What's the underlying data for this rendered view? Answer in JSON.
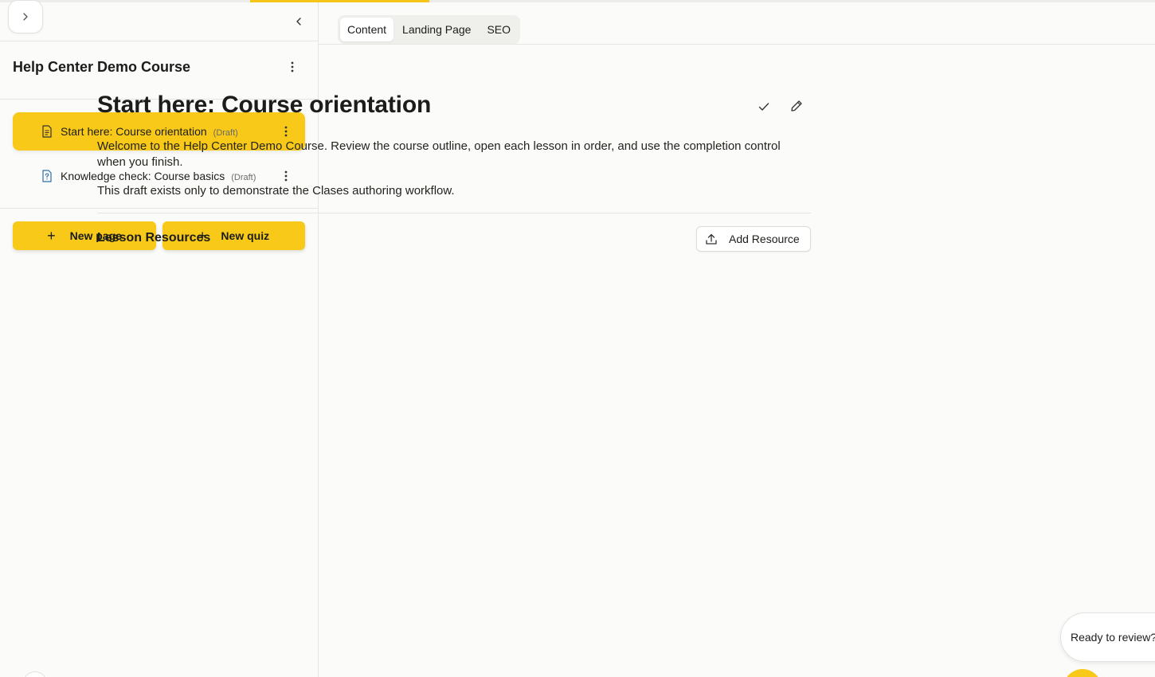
{
  "sidebar": {
    "course_title": "Help Center Demo Course",
    "lessons": [
      {
        "label": "Start here: Course orientation",
        "status": "(Draft)",
        "icon": "document-icon",
        "active": true
      },
      {
        "label": "Knowledge check: Course basics",
        "status": "(Draft)",
        "icon": "quiz-icon",
        "active": false
      }
    ],
    "new_page_label": "New page",
    "new_quiz_label": "New quiz"
  },
  "tabs": [
    {
      "label": "Content",
      "active": true
    },
    {
      "label": "Landing Page",
      "active": false
    },
    {
      "label": "SEO",
      "active": false
    }
  ],
  "main": {
    "title": "Start here: Course orientation",
    "paragraphs": [
      "Welcome to the Help Center Demo Course. Review the course outline, open each lesson in order, and use the completion control when you finish.",
      "This draft exists only to demonstrate the Clases authoring workflow."
    ],
    "resources_title": "Lesson Resources",
    "add_resource_label": "Add Resource"
  },
  "review_prompt": "Ready to review?",
  "colors": {
    "accent": "#f8c918",
    "background": "#fbfbf9",
    "border": "#e5e5e2"
  }
}
